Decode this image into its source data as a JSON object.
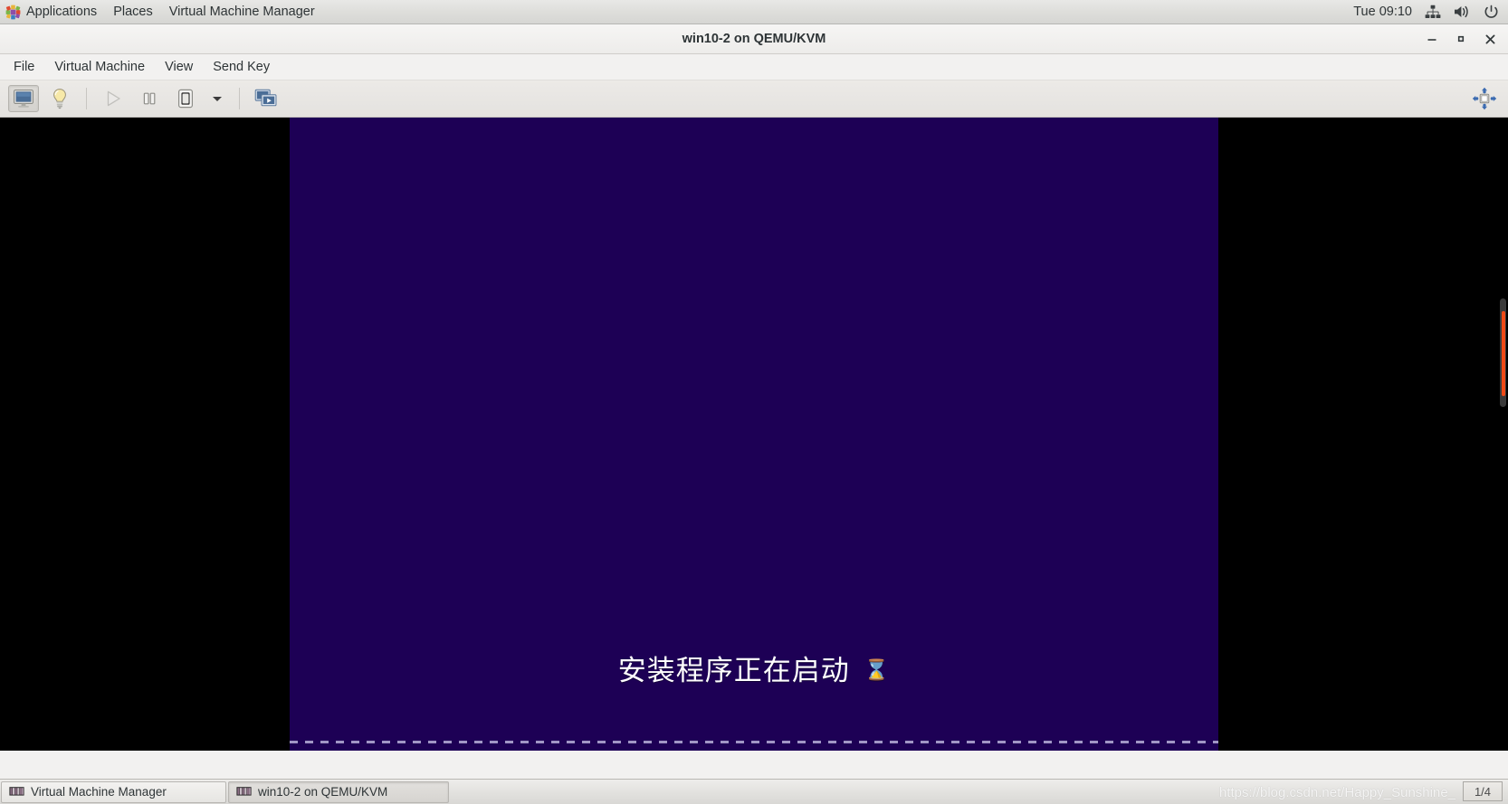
{
  "desktop_panel": {
    "apps_menu": "Applications",
    "places_menu": "Places",
    "active_app": "Virtual Machine Manager",
    "clock": "Tue 09:10",
    "tray": [
      {
        "icon": "network-icon",
        "name": "network-icon"
      },
      {
        "icon": "volume-icon",
        "name": "volume-icon"
      },
      {
        "icon": "power-icon",
        "name": "power-icon"
      }
    ]
  },
  "window": {
    "title": "win10-2 on QEMU/KVM",
    "controls": {
      "minimize": "–",
      "maximize": "▫",
      "close": "✕"
    }
  },
  "menubar": {
    "items": [
      {
        "label": "File"
      },
      {
        "label": "Virtual Machine"
      },
      {
        "label": "View"
      },
      {
        "label": "Send Key"
      }
    ]
  },
  "toolbar": {
    "buttons": [
      {
        "name": "console-view-button",
        "icon": "monitor-icon",
        "state": "active"
      },
      {
        "name": "details-view-button",
        "icon": "lightbulb-icon",
        "state": "normal"
      },
      {
        "name": "run-button",
        "icon": "play-icon",
        "state": "disabled"
      },
      {
        "name": "pause-button",
        "icon": "pause-icon",
        "state": "normal"
      },
      {
        "name": "shutdown-button",
        "icon": "power-switch-icon",
        "state": "normal"
      },
      {
        "name": "shutdown-menu-button",
        "icon": "chevron-down-icon",
        "state": "normal"
      },
      {
        "name": "snapshots-button",
        "icon": "snapshot-icon",
        "state": "normal"
      },
      {
        "name": "fullscreen-button",
        "icon": "resize-arrows-icon",
        "state": "normal"
      }
    ]
  },
  "vm_display": {
    "message": "安装程序正在启动",
    "cursor_icon": "hourglass-icon",
    "cursor_glyph": "⌛",
    "background_color": "#1d0055",
    "letterbox_color": "#000000",
    "scrollbar_color": "#f04a16"
  },
  "taskbar": {
    "tasks": [
      {
        "label": "Virtual Machine Manager",
        "active": false
      },
      {
        "label": "win10-2 on QEMU/KVM",
        "active": true
      }
    ],
    "watermark": "https://blog.csdn.net/Happy_Sunshine_",
    "workspace": "1/4"
  }
}
